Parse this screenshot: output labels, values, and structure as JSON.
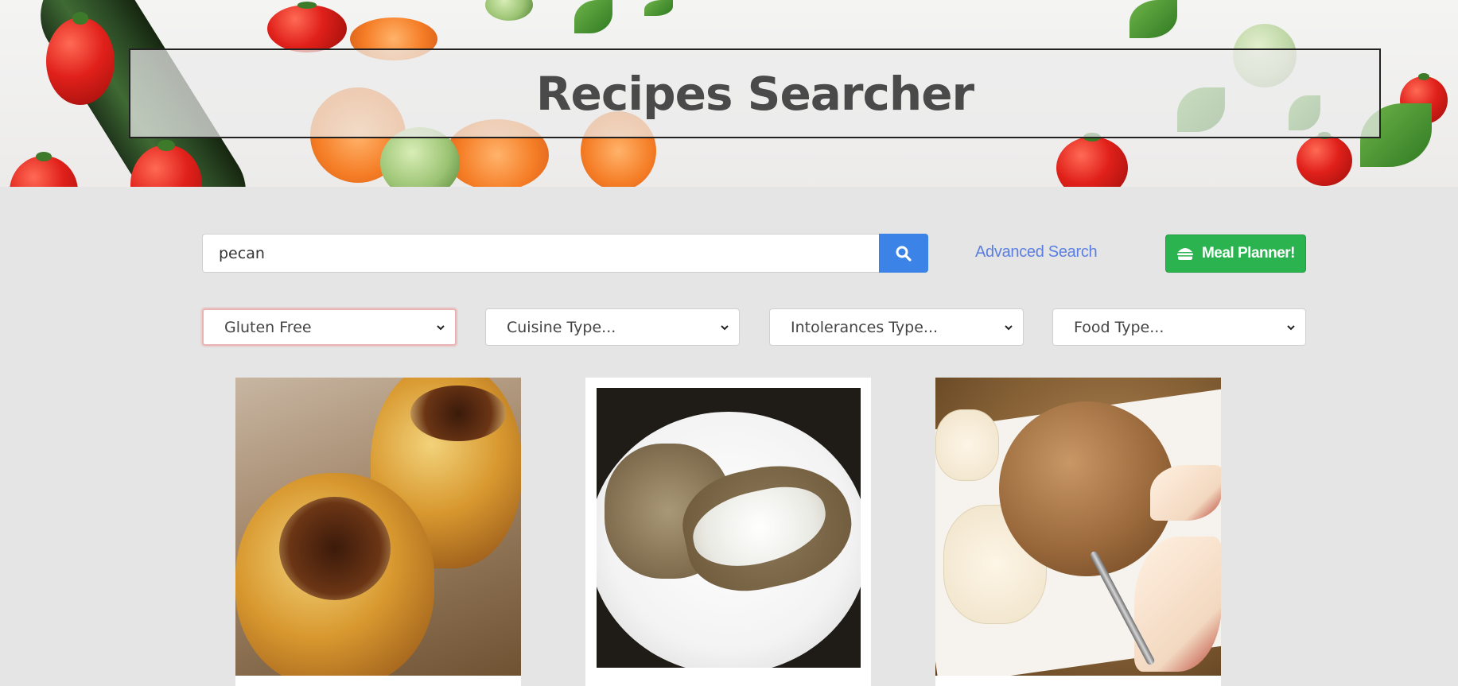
{
  "header": {
    "title": "Recipes Searcher"
  },
  "search": {
    "value": "pecan",
    "placeholder": "",
    "button_icon": "search-icon"
  },
  "links": {
    "advanced_search": "Advanced Search"
  },
  "meal_planner": {
    "label": "Meal Planner!",
    "icon": "burger-icon",
    "color": "#2ab34e"
  },
  "filters": [
    {
      "label": "Gluten Free"
    },
    {
      "label": "Cuisine Type..."
    },
    {
      "label": "Intolerances Type..."
    },
    {
      "label": "Food Type..."
    }
  ],
  "colors": {
    "search_button": "#3b83e6",
    "link": "#5b7fe0",
    "page_background": "#e5e5e5"
  }
}
